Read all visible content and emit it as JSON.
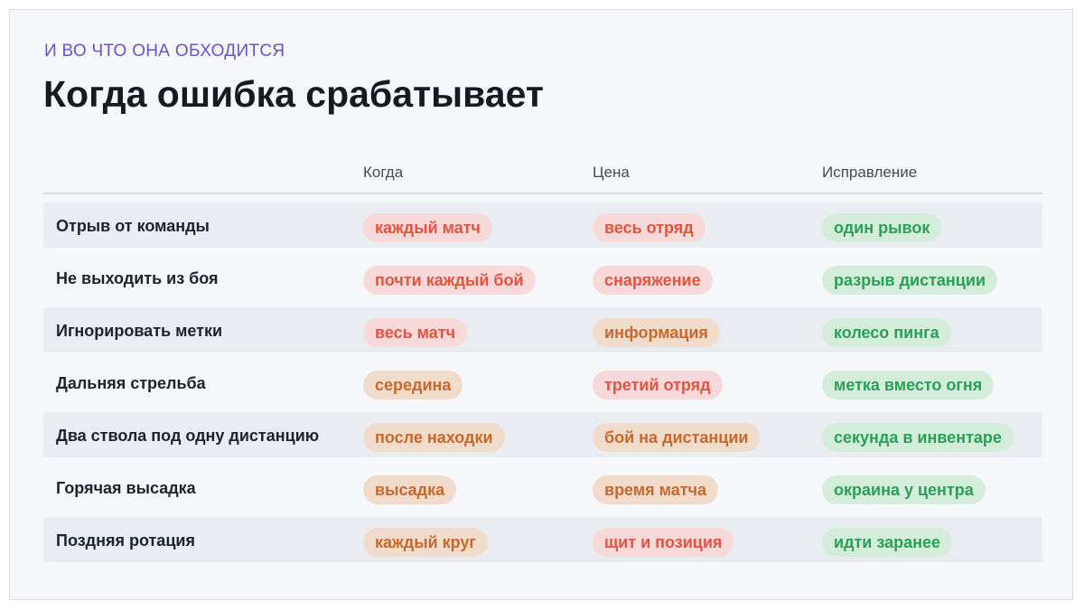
{
  "header": {
    "eyebrow": "И ВО ЧТО ОНА ОБХОДИТСЯ",
    "title": "Когда ошибка срабатывает"
  },
  "table": {
    "columns": [
      "",
      "Когда",
      "Цена",
      "Исправление"
    ],
    "rows": [
      {
        "label": "Отрыв от команды",
        "when": "каждый матч",
        "cost": "весь отряд",
        "fix": "один рывок"
      },
      {
        "label": "Не выходить из боя",
        "when": "почти каждый бой",
        "cost": "снаряжение",
        "fix": "разрыв дистанции"
      },
      {
        "label": "Игнорировать метки",
        "when": "весь матч",
        "cost": "информация",
        "fix": "колесо пинга"
      },
      {
        "label": "Дальняя стрельба",
        "when": "середина",
        "cost": "третий отряд",
        "fix": "метка вместо огня"
      },
      {
        "label": "Два ствола под одну дистанцию",
        "when": "после находки",
        "cost": "бой на дистанции",
        "fix": "секунда в инвентаре"
      },
      {
        "label": "Горячая высадка",
        "when": "высадка",
        "cost": "время матча",
        "fix": "окраина у центра"
      },
      {
        "label": "Поздняя ротация",
        "when": "каждый круг",
        "cost": "щит и позиция",
        "fix": "идти заранее"
      }
    ]
  },
  "colors": {
    "accent": "#6b52c8",
    "severe": "#e25441",
    "moderate": "#c8682d",
    "fix": "#2a9f57"
  }
}
